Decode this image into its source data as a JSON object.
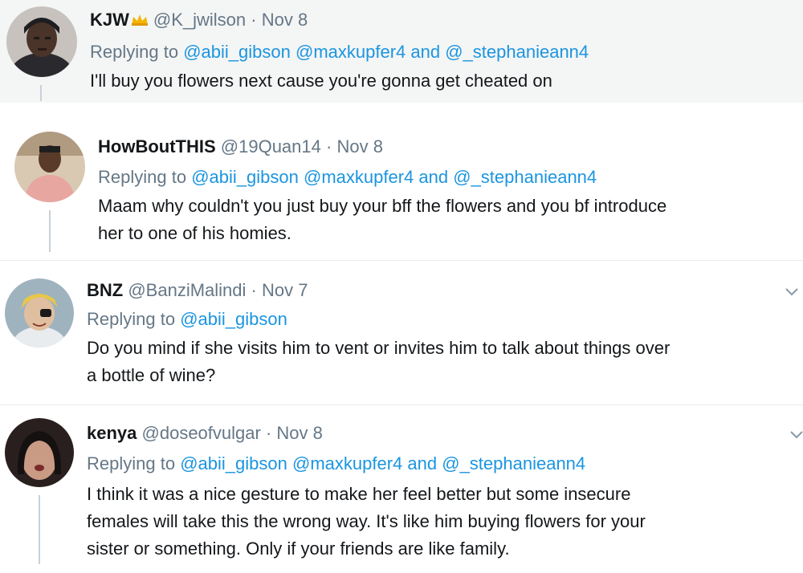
{
  "tweets": [
    {
      "name": "KJW",
      "badge_icon": "crown-emoji-icon",
      "handle": "@K_jwilson",
      "sep": "·",
      "date": "Nov 8",
      "replying_prefix": "Replying to",
      "mentions": [
        "@abii_gibson",
        "@maxkupfer4",
        "@_stephanieann4"
      ],
      "and_word": "and",
      "text": "I'll buy you flowers next cause you're gonna get cheated on"
    },
    {
      "name": "HowBoutTHIS",
      "handle": "@19Quan14",
      "sep": "·",
      "date": "Nov 8",
      "replying_prefix": "Replying to",
      "mentions": [
        "@abii_gibson",
        "@maxkupfer4",
        "@_stephanieann4"
      ],
      "and_word": "and",
      "text_lines": [
        "Maam why couldn't you just buy your bff the flowers and you bf introduce",
        "her to one of his homies."
      ]
    },
    {
      "name": "BNZ",
      "handle": "@BanziMalindi",
      "sep": "·",
      "date": "Nov 7",
      "replying_prefix": "Replying to",
      "mentions": [
        "@abii_gibson"
      ],
      "text_lines": [
        "Do you mind if she visits him to vent or invites him to talk about things over",
        "a bottle of wine?"
      ],
      "menu_icon": "chevron-down-icon"
    },
    {
      "name": "kenya",
      "handle": "@doseofvulgar",
      "sep": "·",
      "date": "Nov 8",
      "replying_prefix": "Replying to",
      "mentions": [
        "@abii_gibson",
        "@maxkupfer4",
        "@_stephanieann4"
      ],
      "and_word": "and",
      "text_lines": [
        "I think it was a nice gesture to make her feel better but some insecure",
        "females will take this the wrong way. It's like him buying flowers for your",
        "sister or something. Only if your friends are like family."
      ],
      "menu_icon": "chevron-down-icon"
    }
  ],
  "colors": {
    "mention": "#1b95e0",
    "meta": "#657786",
    "text": "#14171a",
    "first_bg": "#f4f5f5",
    "divider": "#e6ecf0"
  }
}
